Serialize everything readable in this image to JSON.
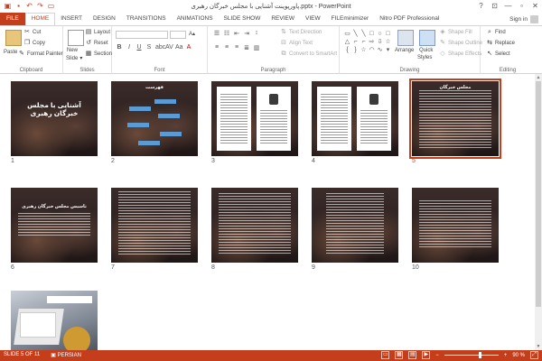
{
  "window": {
    "title": "پاورپوینت آشنایی با مجلس خبرگان رهبری.pptx - PowerPoint",
    "controls": {
      "help": "?",
      "minimize": "—",
      "restore": "▫",
      "close": "✕"
    }
  },
  "tabs": [
    "FILE",
    "HOME",
    "INSERT",
    "DESIGN",
    "TRANSITIONS",
    "ANIMATIONS",
    "SLIDE SHOW",
    "REVIEW",
    "VIEW",
    "FILEminimizer",
    "Nitro PDF Professional"
  ],
  "signin": "Sign in",
  "ribbon": {
    "clipboard": {
      "label": "Clipboard",
      "paste": "Paste",
      "cut": "Cut",
      "copy": "Copy",
      "format_painter": "Format Painter"
    },
    "slides": {
      "label": "Slides",
      "new_slide": "New",
      "new_slide_2": "Slide",
      "layout": "Layout",
      "reset": "Reset",
      "section": "Section"
    },
    "font": {
      "label": "Font"
    },
    "paragraph": {
      "label": "Paragraph",
      "text_direction": "Text Direction",
      "align_text": "Align Text",
      "convert_smartart": "Convert to SmartArt"
    },
    "drawing": {
      "label": "Drawing",
      "arrange": "Arrange",
      "quick_styles": "Quick",
      "quick_styles_2": "Styles",
      "shape_fill": "Shape Fill",
      "shape_outline": "Shape Outline",
      "shape_effects": "Shape Effects"
    },
    "editing": {
      "label": "Editing",
      "find": "Find",
      "replace": "Replace",
      "select": "Select"
    }
  },
  "slides": [
    {
      "num": "1",
      "title": "آشنایی با مجلس خبرگان رهبری"
    },
    {
      "num": "2",
      "title": "فهرست"
    },
    {
      "num": "3"
    },
    {
      "num": "4"
    },
    {
      "num": "5",
      "title": "مجلس خبرگان"
    },
    {
      "num": "6",
      "title": "تاسیس مجلس خبرگان رهبری"
    },
    {
      "num": "7"
    },
    {
      "num": "8"
    },
    {
      "num": "9"
    },
    {
      "num": "10"
    },
    {
      "num": "11"
    }
  ],
  "status": {
    "slide": "SLIDE 5 OF 11",
    "language": "PERSIAN",
    "zoom": "90 %"
  }
}
